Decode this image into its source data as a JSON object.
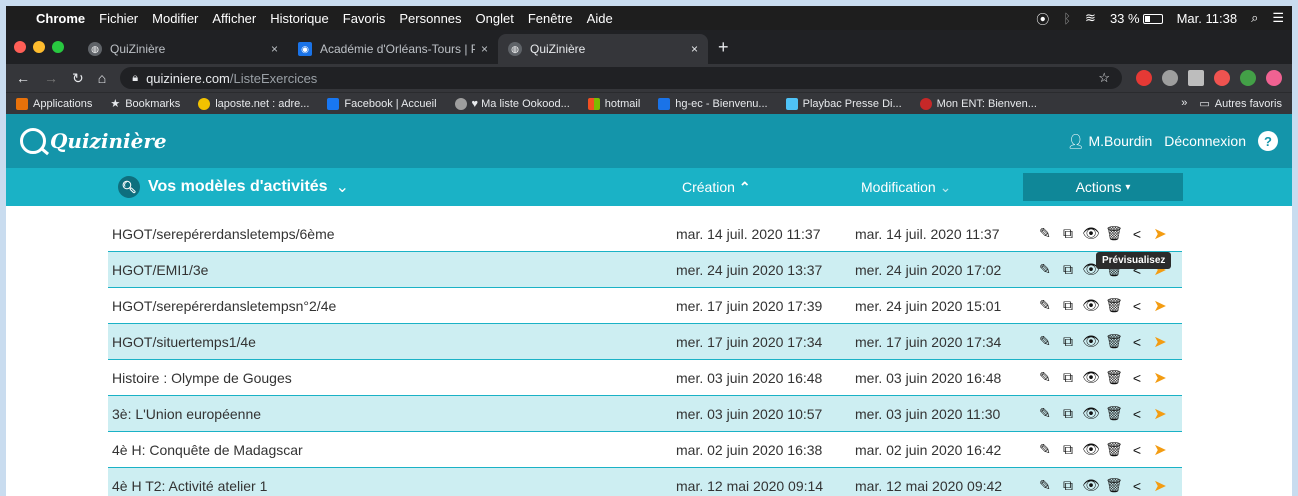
{
  "menubar": {
    "items": [
      "Chrome",
      "Fichier",
      "Modifier",
      "Afficher",
      "Historique",
      "Favoris",
      "Personnes",
      "Onglet",
      "Fenêtre",
      "Aide"
    ],
    "battery": "33 %",
    "clock": "Mar. 11:38"
  },
  "tabs": [
    {
      "label": "QuiZinière",
      "close": "×"
    },
    {
      "label": "Académie d'Orléans-Tours | Po",
      "close": "×"
    },
    {
      "label": "QuiZinière",
      "close": "×"
    }
  ],
  "newtab": "+",
  "address": {
    "domain": "quiziniere.com",
    "path": "/ListeExercices"
  },
  "bookmarks": {
    "items": [
      "Applications",
      "Bookmarks",
      "laposte.net : adre...",
      "Facebook | Accueil",
      "♥ Ma liste Ookood...",
      "hotmail",
      "hg-ec - Bienvenu...",
      "Playbac Presse Di...",
      "Mon ENT: Bienven..."
    ],
    "more": "»",
    "other": "Autres favoris"
  },
  "site": {
    "logo": "Quizinière",
    "user": "M.Bourdin",
    "logout": "Déconnexion",
    "help": "?"
  },
  "table": {
    "title": "Vos modèles d'activités",
    "col_creation": "Création",
    "col_modification": "Modification",
    "actions": "Actions",
    "rows": [
      {
        "name": "HGOT/serepérerdansletemps/6ème",
        "created": "mar. 14 juil. 2020 11:37",
        "modified": "mar. 14 juil. 2020 11:37"
      },
      {
        "name": "HGOT/EMI1/3e",
        "created": "mer. 24 juin 2020 13:37",
        "modified": "mer. 24 juin 2020 17:02"
      },
      {
        "name": "HGOT/serepérerdansletempsn°2/4e",
        "created": "mer. 17 juin 2020 17:39",
        "modified": "mer. 24 juin 2020 15:01"
      },
      {
        "name": "HGOT/situertemps1/4e",
        "created": "mer. 17 juin 2020 17:34",
        "modified": "mer. 17 juin 2020 17:34"
      },
      {
        "name": "Histoire : Olympe de Gouges",
        "created": "mer. 03 juin 2020 16:48",
        "modified": "mer. 03 juin 2020 16:48"
      },
      {
        "name": "3è: L'Union européenne",
        "created": "mer. 03 juin 2020 10:57",
        "modified": "mer. 03 juin 2020 11:30"
      },
      {
        "name": "4è H: Conquête de Madagscar",
        "created": "mar. 02 juin 2020 16:38",
        "modified": "mar. 02 juin 2020 16:42"
      },
      {
        "name": "4è H T2: Activité atelier 1",
        "created": "mar. 12 mai 2020 09:14",
        "modified": "mar. 12 mai 2020 09:42"
      }
    ]
  },
  "tooltip": "Prévisualisez",
  "colors": {
    "header": "#1495aa",
    "table_header": "#1ab2c6",
    "row_alt": "#cdeef2",
    "send": "#f39c12"
  }
}
